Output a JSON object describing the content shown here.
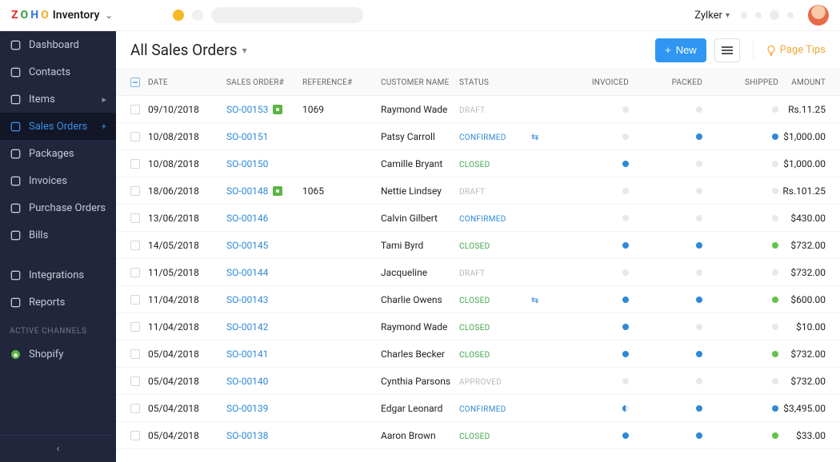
{
  "topbar": {
    "brand_app": "Inventory",
    "org_name": "Zylker"
  },
  "sidebar": {
    "items": [
      {
        "icon": "home",
        "label": "Dashboard"
      },
      {
        "icon": "user",
        "label": "Contacts"
      },
      {
        "icon": "basket",
        "label": "Items",
        "trailing": "chevron"
      },
      {
        "icon": "cart",
        "label": "Sales Orders",
        "trailing": "plus",
        "active": true
      },
      {
        "icon": "box",
        "label": "Packages"
      },
      {
        "icon": "doc",
        "label": "Invoices"
      },
      {
        "icon": "bag",
        "label": "Purchase Orders"
      },
      {
        "icon": "calc",
        "label": "Bills"
      },
      {
        "icon": "plug",
        "label": "Integrations",
        "gap": true
      },
      {
        "icon": "graph",
        "label": "Reports"
      }
    ],
    "section_label": "ACTIVE CHANNELS",
    "channels": [
      {
        "icon": "shopify",
        "label": "Shopify"
      }
    ]
  },
  "toolbar": {
    "title": "All Sales Orders",
    "new_label": "New",
    "page_tips": "Page Tips"
  },
  "table": {
    "headers": {
      "date": "DATE",
      "so": "SALES ORDER#",
      "ref": "REFERENCE#",
      "cust": "CUSTOMER NAME",
      "status": "STATUS",
      "inv": "INVOICED",
      "pack": "PACKED",
      "ship": "SHIPPED",
      "amt": "AMOUNT"
    },
    "rows": [
      {
        "date": "09/10/2018",
        "so": "SO-00153",
        "shop": true,
        "ref": "1069",
        "cust": "Raymond Wade",
        "status": "DRAFT",
        "inv": "empty",
        "pack": "empty",
        "ship": "empty",
        "amt": "Rs.11.25"
      },
      {
        "date": "10/08/2018",
        "so": "SO-00151",
        "shop": false,
        "ref": "",
        "cust": "Patsy Carroll",
        "status": "CONFIRMED",
        "sync": true,
        "inv": "empty",
        "pack": "filled",
        "ship": "filled",
        "amt": "$1,000.00"
      },
      {
        "date": "10/08/2018",
        "so": "SO-00150",
        "shop": false,
        "ref": "",
        "cust": "Camille Bryant",
        "status": "CLOSED",
        "inv": "filled",
        "pack": "empty",
        "ship": "empty",
        "amt": "$1,000.00"
      },
      {
        "date": "18/06/2018",
        "so": "SO-00148",
        "shop": true,
        "ref": "1065",
        "cust": "Nettie Lindsey",
        "status": "DRAFT",
        "inv": "empty",
        "pack": "empty",
        "ship": "empty",
        "amt": "Rs.101.25"
      },
      {
        "date": "13/06/2018",
        "so": "SO-00146",
        "shop": false,
        "ref": "",
        "cust": "Calvin Gilbert",
        "status": "CONFIRMED",
        "inv": "empty",
        "pack": "empty",
        "ship": "empty",
        "amt": "$430.00"
      },
      {
        "date": "14/05/2018",
        "so": "SO-00145",
        "shop": false,
        "ref": "",
        "cust": "Tami Byrd",
        "status": "CLOSED",
        "inv": "filled",
        "pack": "filled",
        "ship": "green",
        "amt": "$732.00"
      },
      {
        "date": "11/05/2018",
        "so": "SO-00144",
        "shop": false,
        "ref": "",
        "cust": "Jacqueline",
        "status": "DRAFT",
        "inv": "empty",
        "pack": "empty",
        "ship": "empty",
        "amt": "$732.00"
      },
      {
        "date": "11/04/2018",
        "so": "SO-00143",
        "shop": false,
        "ref": "",
        "cust": "Charlie Owens",
        "status": "CLOSED",
        "sync": true,
        "inv": "filled",
        "pack": "filled",
        "ship": "green",
        "amt": "$600.00"
      },
      {
        "date": "11/04/2018",
        "so": "SO-00142",
        "shop": false,
        "ref": "",
        "cust": "Raymond Wade",
        "status": "CLOSED",
        "inv": "filled",
        "pack": "empty",
        "ship": "empty",
        "amt": "$10.00"
      },
      {
        "date": "05/04/2018",
        "so": "SO-00141",
        "shop": false,
        "ref": "",
        "cust": "Charles Becker",
        "status": "CLOSED",
        "inv": "filled",
        "pack": "filled",
        "ship": "green",
        "amt": "$732.00"
      },
      {
        "date": "05/04/2018",
        "so": "SO-00140",
        "shop": false,
        "ref": "",
        "cust": "Cynthia Parsons",
        "status": "APPROVED",
        "inv": "empty",
        "pack": "empty",
        "ship": "empty",
        "amt": "$732.00"
      },
      {
        "date": "05/04/2018",
        "so": "SO-00139",
        "shop": false,
        "ref": "",
        "cust": "Edgar Leonard",
        "status": "CONFIRMED",
        "inv": "half",
        "pack": "filled",
        "ship": "filled",
        "amt": "$3,495.00"
      },
      {
        "date": "05/04/2018",
        "so": "SO-00138",
        "shop": false,
        "ref": "",
        "cust": "Aaron Brown",
        "status": "CLOSED",
        "inv": "filled",
        "pack": "filled",
        "ship": "green",
        "amt": "$33.00"
      }
    ]
  }
}
